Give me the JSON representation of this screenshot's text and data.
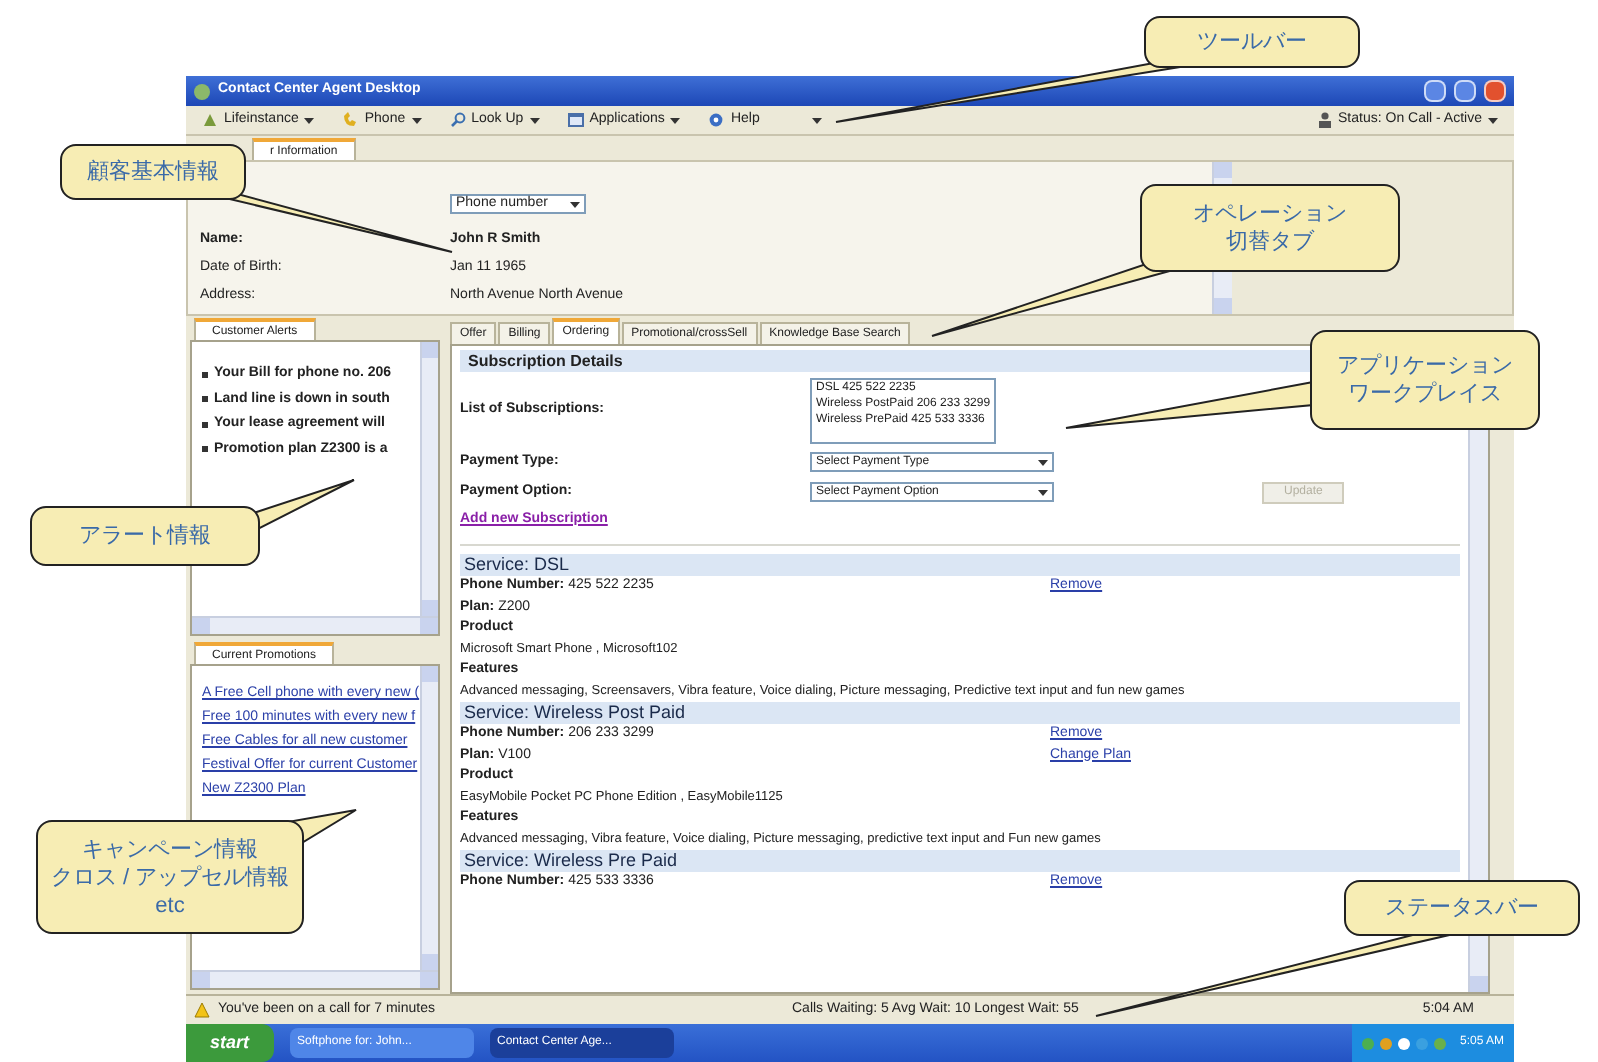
{
  "window": {
    "title": "Contact Center Agent Desktop"
  },
  "toolbar": {
    "items": [
      {
        "kind": "menu",
        "label": "Lifeinstance"
      },
      {
        "kind": "menu",
        "label": "Phone"
      },
      {
        "kind": "menu",
        "label": "Look Up"
      },
      {
        "kind": "menu",
        "label": "Applications"
      },
      {
        "kind": "plain",
        "label": "Help"
      },
      {
        "kind": "caret"
      }
    ],
    "status": "Status: On Call - Active"
  },
  "customer_info": {
    "tab": "r Information",
    "lookup": "Phone number",
    "fields": [
      {
        "label": "Name:",
        "value": "John R Smith",
        "emphasis": true
      },
      {
        "label": "Date of Birth:",
        "value": "Jan 11 1965",
        "emphasis": false
      },
      {
        "label": "Address:",
        "value": "North Avenue North Avenue",
        "emphasis": false
      }
    ]
  },
  "alerts": {
    "title": "Customer Alerts",
    "items": [
      "Your Bill for phone no. 206",
      "Land line is down in south",
      "Your lease agreement will",
      "Promotion plan Z2300 is a"
    ]
  },
  "promotions": {
    "title": "Current Promotions",
    "items": [
      "A Free Cell phone with every new (",
      "Free 100 minutes with every new f",
      "Free Cables for all new customer",
      "Festival Offer for current Customer",
      "New Z2300 Plan"
    ]
  },
  "workspace": {
    "tabs": [
      {
        "label": "Offer",
        "selected": false
      },
      {
        "label": "Billing",
        "selected": false
      },
      {
        "label": "Ordering",
        "selected": true
      },
      {
        "label": "Promotional/crossSell",
        "selected": false
      },
      {
        "label": "Knowledge Base Search",
        "selected": false
      }
    ],
    "subscription_details": {
      "title": "Subscription Details",
      "list_label": "List of Subscriptions:",
      "subscriptions": [
        "DSL 425 522 2235",
        "Wireless PostPaid 206 233 3299",
        "Wireless PrePaid 425 533 3336"
      ],
      "payment_type": {
        "label": "Payment Type:",
        "value": "Select Payment Type"
      },
      "payment_option": {
        "label": "Payment Option:",
        "value": "Select Payment Option"
      },
      "button": {
        "label": "Update",
        "disabled": true
      },
      "link": "Add new Subscription"
    },
    "services": [
      {
        "title": "Service: DSL",
        "rows": [
          {
            "kind": "pair",
            "label": "Phone Number:",
            "value": "425 522 2235",
            "action": "Remove"
          },
          {
            "kind": "pair",
            "label": "Plan:",
            "value": "Z200"
          },
          {
            "kind": "heading",
            "label": "Product"
          },
          {
            "kind": "text",
            "value": "Microsoft Smart Phone , Microsoft102"
          },
          {
            "kind": "heading",
            "label": "Features"
          },
          {
            "kind": "text",
            "value": "Advanced messaging, Screensavers, Vibra feature, Voice dialing, Picture messaging, Predictive text input and fun new games"
          }
        ]
      },
      {
        "title": "Service: Wireless Post Paid",
        "rows": [
          {
            "kind": "pair",
            "label": "Phone Number:",
            "value": "206 233 3299",
            "action": "Remove"
          },
          {
            "kind": "pair",
            "label": "Plan:",
            "value": "V100",
            "action": "Change Plan"
          },
          {
            "kind": "heading",
            "label": "Product"
          },
          {
            "kind": "text",
            "value": "EasyMobile Pocket PC Phone Edition , EasyMobile1125"
          },
          {
            "kind": "heading",
            "label": "Features"
          },
          {
            "kind": "text",
            "value": "Advanced messaging, Vibra feature, Voice dialing, Picture messaging, predictive text input and Fun new games"
          }
        ]
      },
      {
        "title": "Service: Wireless Pre Paid",
        "rows": [
          {
            "kind": "pair",
            "label": "Phone Number:",
            "value": "425 533 3336",
            "action": "Remove"
          }
        ]
      }
    ]
  },
  "status_bar": {
    "message": "You've been on a call for 7 minutes",
    "queue": "Calls Waiting: 5 Avg Wait: 10 Longest Wait: 55",
    "time": "5:04 AM"
  },
  "taskbar": {
    "start": "start",
    "tasks": [
      {
        "label": "Softphone for: John...",
        "selected": false
      },
      {
        "label": "Contact Center Age...",
        "selected": true
      }
    ],
    "clock": "5:05 AM"
  },
  "callouts": [
    {
      "lines": [
        "ツールバー"
      ]
    },
    {
      "lines": [
        "顧客基本情報"
      ]
    },
    {
      "lines": [
        "オペレーション",
        "切替タブ"
      ]
    },
    {
      "lines": [
        "アプリケーション",
        "ワークプレイス"
      ]
    },
    {
      "lines": [
        "アラート情報"
      ]
    },
    {
      "lines": [
        "キャンペーン情報",
        "クロス / アップセル情報",
        "etc"
      ]
    },
    {
      "lines": [
        "ステータスバー"
      ]
    }
  ]
}
